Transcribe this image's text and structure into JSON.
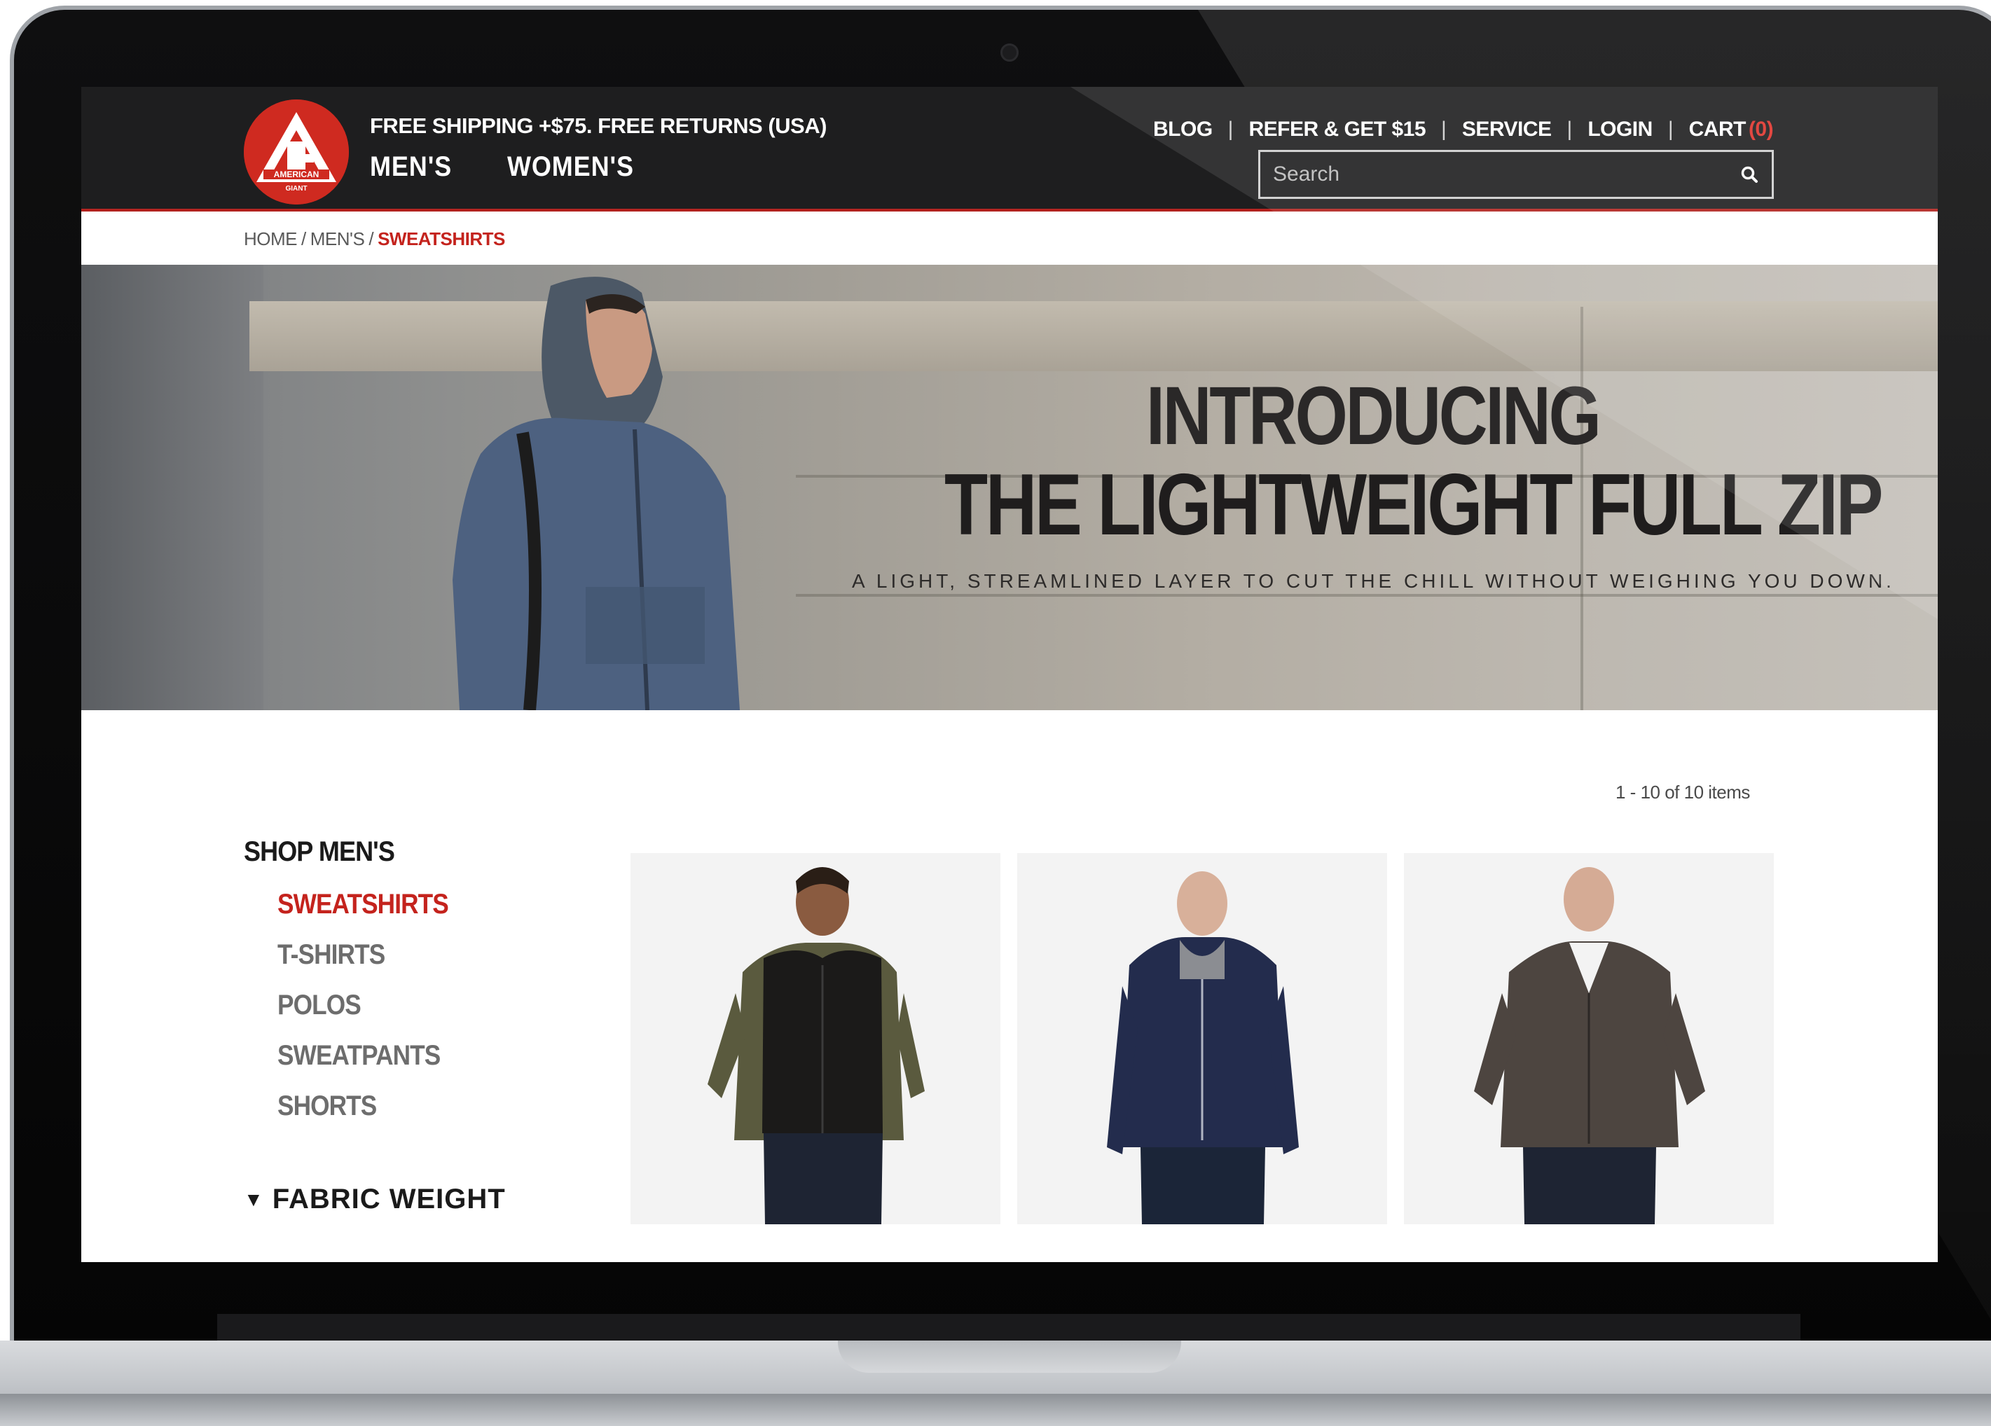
{
  "header": {
    "logo_text": "AMERICAN GIANT",
    "promo": "FREE SHIPPING +$75. FREE RETURNS (USA)",
    "main_nav": [
      "MEN'S",
      "WOMEN'S"
    ],
    "utility_nav": {
      "blog": "BLOG",
      "refer": "REFER & GET $15",
      "service": "SERVICE",
      "login": "LOGIN",
      "cart": "CART",
      "cart_count": "(0)"
    },
    "search": {
      "placeholder": "Search",
      "icon": "search-icon"
    }
  },
  "breadcrumb": {
    "home": "HOME",
    "mens": "MEN'S",
    "current": "SWEATSHIRTS"
  },
  "hero": {
    "title_line1": "INTRODUCING",
    "title_line2": "THE LIGHTWEIGHT FULL ZIP",
    "subtitle": "A LIGHT, STREAMLINED LAYER TO CUT THE CHILL WITHOUT WEIGHING YOU DOWN."
  },
  "listing": {
    "item_count": "1 - 10 of 10 items",
    "sidebar_title": "SHOP MEN'S",
    "categories": [
      "SWEATSHIRTS",
      "T-SHIRTS",
      "POLOS",
      "SWEATPANTS",
      "SHORTS"
    ],
    "active_category": "SWEATSHIRTS",
    "filter_label": "FABRIC WEIGHT"
  },
  "products": [
    {
      "garment": "vest",
      "color": "#1b1a19"
    },
    {
      "garment": "hoodie",
      "color": "#232c4d"
    },
    {
      "garment": "jacket",
      "color": "#4d4540"
    }
  ],
  "colors": {
    "brand_red": "#c4231d",
    "header_bg": "#1e1e1f",
    "cart_count": "#e0342c"
  }
}
